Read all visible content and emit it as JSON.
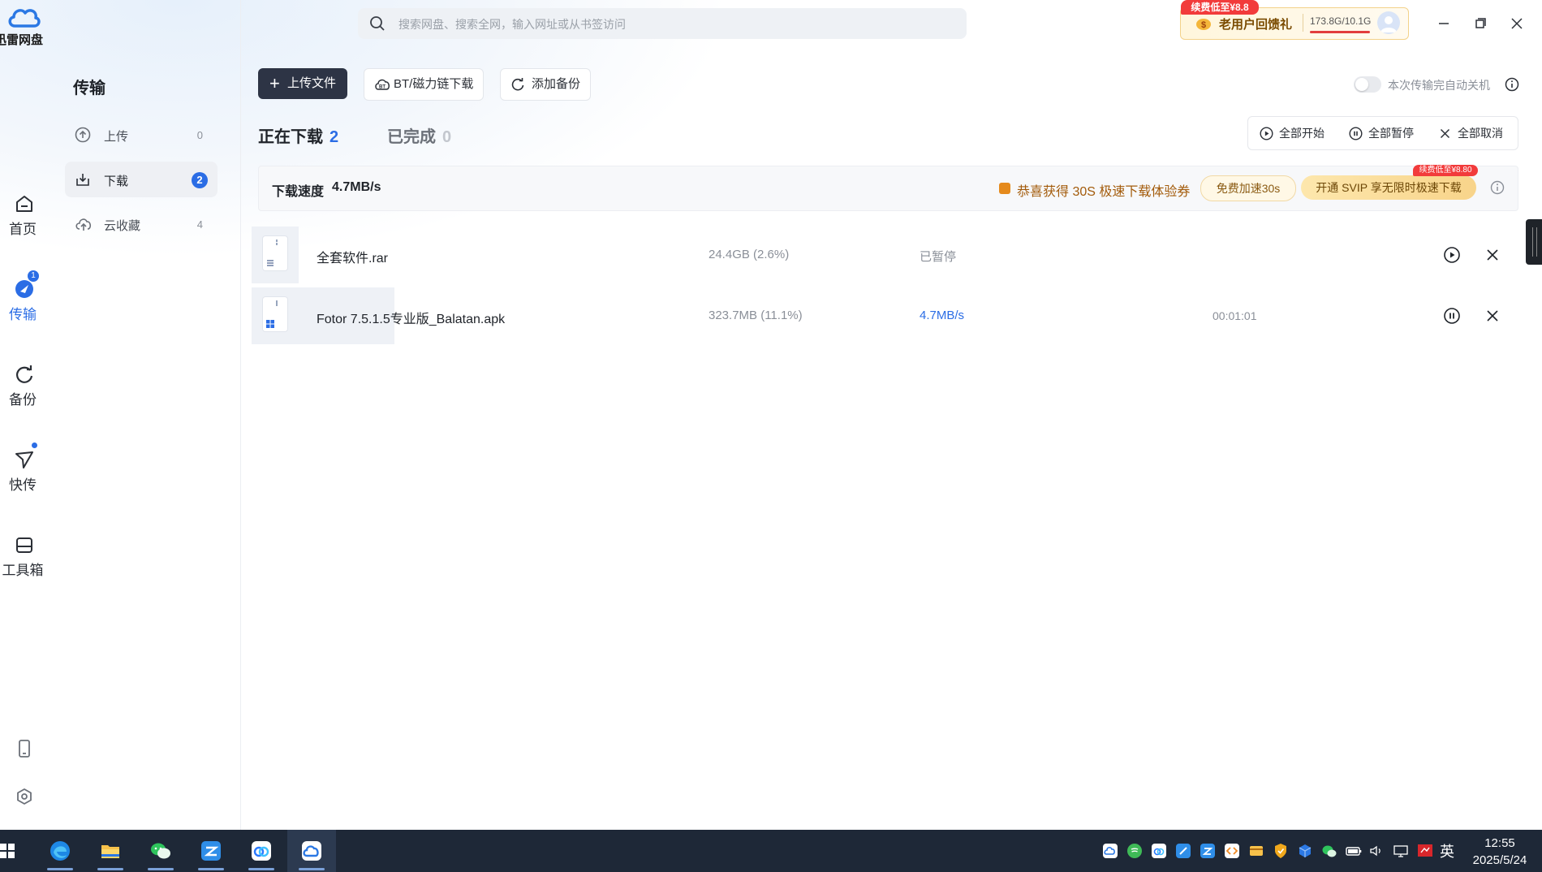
{
  "app": {
    "logo_text": "迅雷网盘"
  },
  "rail": {
    "items": [
      {
        "label": "首页",
        "icon": "home-icon"
      },
      {
        "label": "传输",
        "icon": "transfer-icon",
        "badge": "1"
      },
      {
        "label": "备份",
        "icon": "backup-icon"
      },
      {
        "label": "快传",
        "icon": "quick-send-icon"
      },
      {
        "label": "工具箱",
        "icon": "toolbox-icon"
      }
    ],
    "bottom": [
      {
        "icon": "phone-icon"
      },
      {
        "icon": "settings-icon"
      }
    ]
  },
  "panel": {
    "title": "传输",
    "items": [
      {
        "label": "上传",
        "count": "0",
        "icon": "upload-icon"
      },
      {
        "label": "下载",
        "count": "2",
        "icon": "download-icon",
        "active": true
      },
      {
        "label": "云收藏",
        "count": "4",
        "icon": "cloud-collect-icon"
      }
    ]
  },
  "topbar": {
    "search_placeholder": "搜索网盘、搜索全网，输入网址或从书签访问",
    "promo_tag": "续费低至¥8.8",
    "promo_text": "老用户回馈礼",
    "storage": "173.8G/10.1G",
    "storage_fill": 1.0
  },
  "toolbar": {
    "upload": "上传文件",
    "bt": "BT/磁力链下载",
    "backup": "添加备份",
    "auto_shutdown": "本次传输完自动关机",
    "auto_shutdown_on": false
  },
  "tabs": [
    {
      "label": "正在下载",
      "count": "2"
    },
    {
      "label": "已完成",
      "count": "0"
    }
  ],
  "bulk": {
    "start_all": "全部开始",
    "pause_all": "全部暂停",
    "cancel_all": "全部取消"
  },
  "speedbar": {
    "label": "下载速度",
    "value": "4.7MB/s",
    "experience_text": "恭喜获得 30S 极速下载体验券",
    "free_btn": "免费加速30s",
    "svip_btn": "开通 SVIP 享无限时极速下载",
    "svip_tag": "续费低至¥8.80"
  },
  "downloads": [
    {
      "name": "全套软件.rar",
      "size": "24.4GB (2.6%)",
      "status": "已暂停",
      "time": "",
      "action": "play-icon"
    },
    {
      "name": "Fotor 7.5.1.5专业版_Balatan.apk",
      "size": "323.7MB (11.1%)",
      "status": "4.7MB/s",
      "time": "00:01:01",
      "action": "pause-icon"
    }
  ],
  "taskbar": {
    "apps": [
      "edge-icon",
      "file-explorer-icon",
      "wechat-icon",
      "app-icon",
      "baidu-netdisk-icon",
      "xunlei-netdisk-icon"
    ],
    "ime": "英",
    "time": "12:55",
    "date": "2025/5/24"
  },
  "colors": {
    "accent": "#2b6de5",
    "primary_btn": "#2d3445",
    "taskbar": "#1e2837",
    "promo_red": "#f23b3b"
  }
}
